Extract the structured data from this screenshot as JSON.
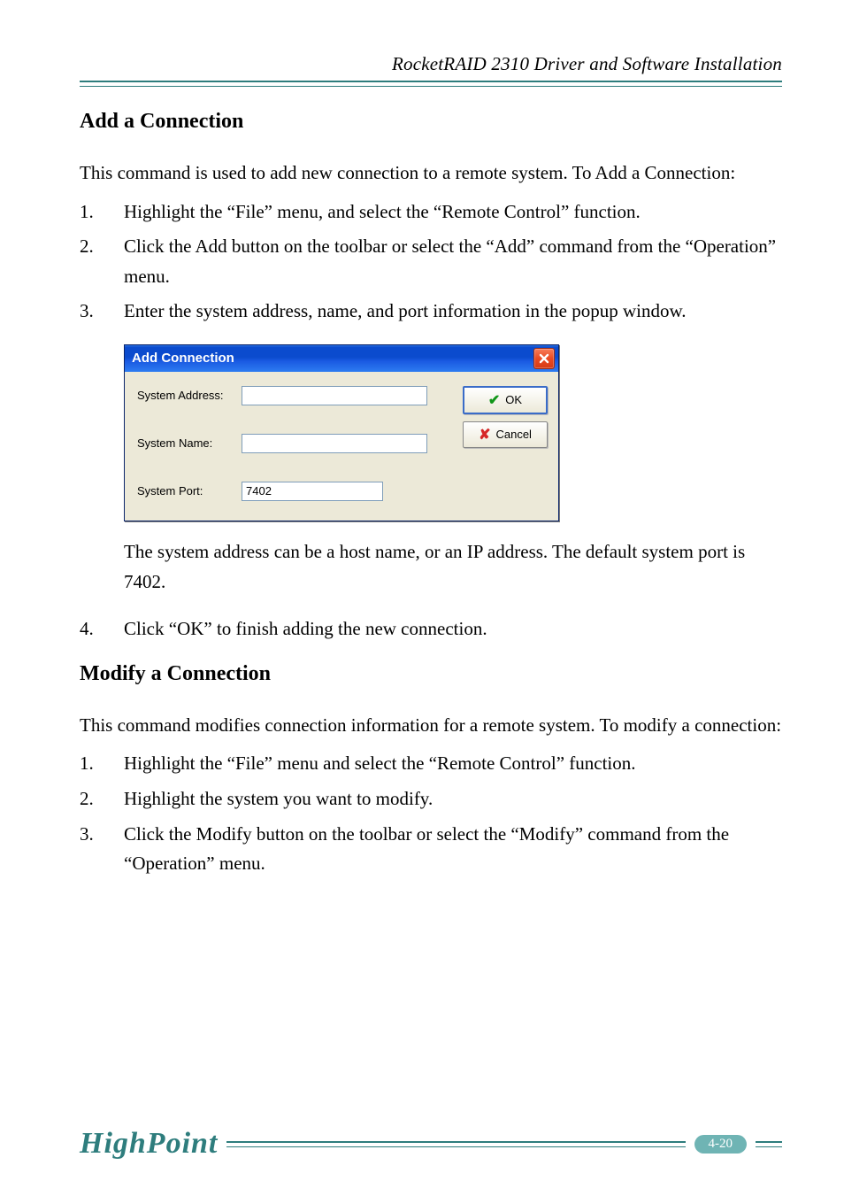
{
  "header": {
    "running_title": "RocketRAID 2310 Driver and Software Installation"
  },
  "sections": {
    "add": {
      "title": "Add a Connection",
      "intro": "This command is used to add new connection to a remote system.  To Add a Connection:",
      "steps": [
        "Highlight the “File” menu, and select the “Remote Control” function.",
        "Click the Add button on the toolbar or select the “Add” command from the “Operation” menu.",
        "Enter the system address, name, and port information in the popup window."
      ],
      "after_dialog": "The system address can be a host name, or an IP address.  The default system port is 7402.",
      "step4": "Click “OK” to finish adding the new connection."
    },
    "modify": {
      "title": "Modify a Connection",
      "intro": "This command modifies connection information for a remote system.  To modify a connection:",
      "steps": [
        "Highlight the “File” menu and select the “Remote Control” function.",
        "Highlight the system you want to modify.",
        "Click the Modify button on the toolbar or select the “Modify” command from the “Operation” menu."
      ]
    }
  },
  "dialog": {
    "title": "Add Connection",
    "labels": {
      "address": "System Address:",
      "name": "System Name:",
      "port": "System Port:"
    },
    "values": {
      "address": "",
      "name": "",
      "port": "7402"
    },
    "buttons": {
      "ok": "OK",
      "cancel": "Cancel"
    }
  },
  "footer": {
    "brand": "HighPoint",
    "page_number": "4-20"
  }
}
